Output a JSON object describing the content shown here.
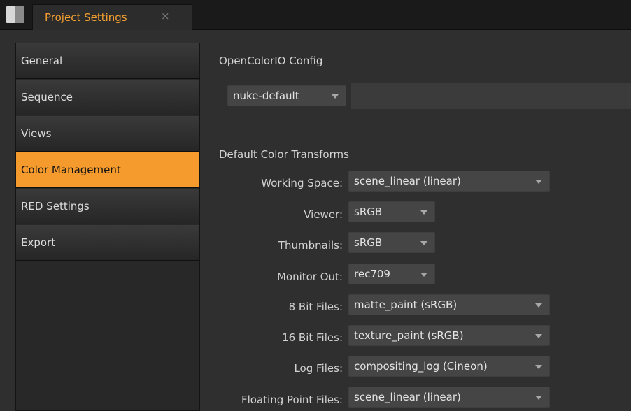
{
  "tab": {
    "title": "Project Settings",
    "close": "×"
  },
  "nav": {
    "items": [
      {
        "label": "General"
      },
      {
        "label": "Sequence"
      },
      {
        "label": "Views"
      },
      {
        "label": "Color Management"
      },
      {
        "label": "RED Settings"
      },
      {
        "label": "Export"
      }
    ],
    "active": "Color Management"
  },
  "ocio": {
    "title": "OpenColorIO Config",
    "config_value": "nuke-default"
  },
  "transforms": {
    "title": "Default Color Transforms",
    "rows": [
      {
        "label": "Working Space:",
        "value": "scene_linear (linear)"
      },
      {
        "label": "Viewer:",
        "value": "sRGB"
      },
      {
        "label": "Thumbnails:",
        "value": "sRGB"
      },
      {
        "label": "Monitor Out:",
        "value": "rec709"
      },
      {
        "label": "8 Bit Files:",
        "value": "matte_paint (sRGB)"
      },
      {
        "label": "16 Bit Files:",
        "value": "texture_paint (sRGB)"
      },
      {
        "label": "Log Files:",
        "value": "compositing_log (Cineon)"
      },
      {
        "label": "Floating Point Files:",
        "value": "scene_linear (linear)"
      }
    ]
  },
  "colors": {
    "accent": "#f59a2c",
    "background": "#2f2f2f"
  }
}
